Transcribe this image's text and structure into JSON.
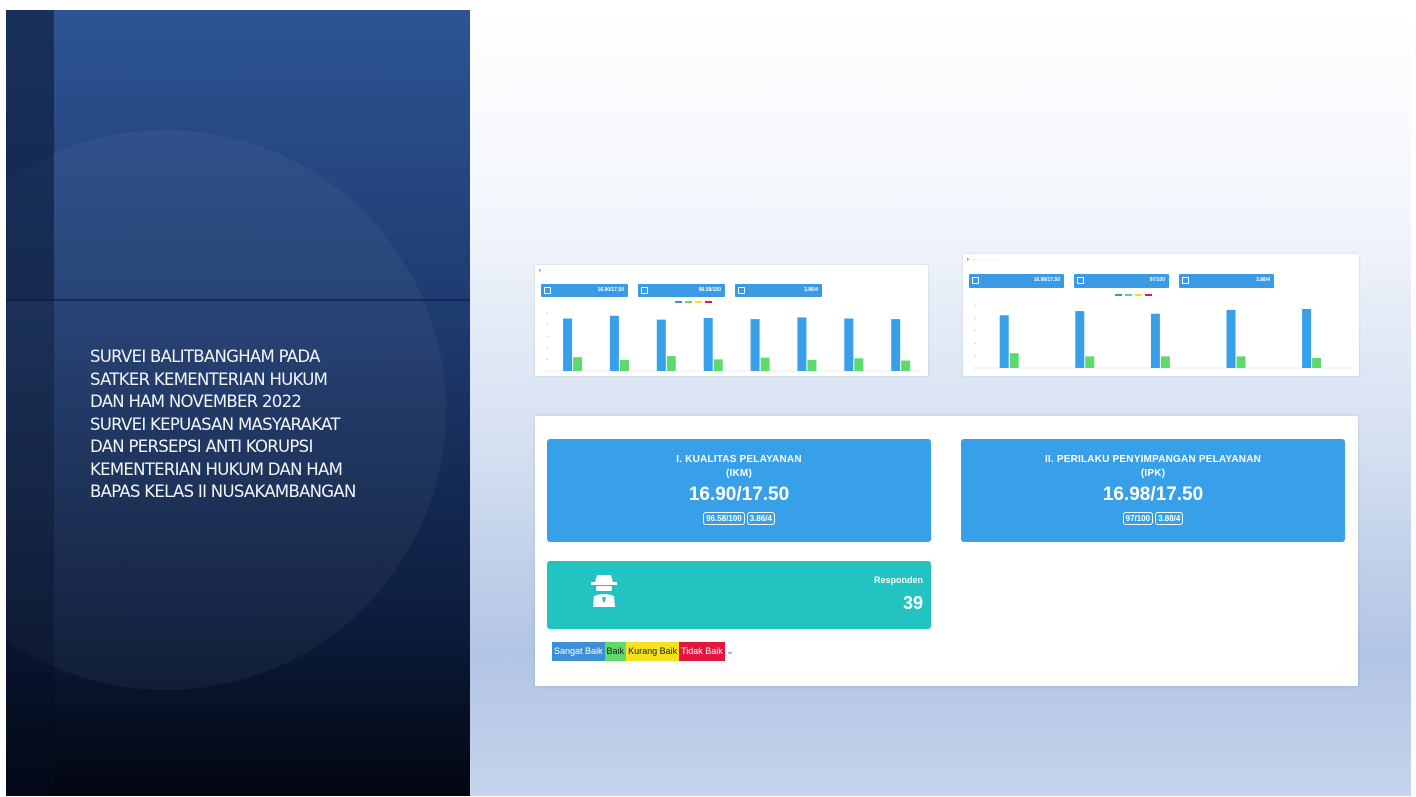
{
  "colors": {
    "blue": "#38a0e8",
    "teal": "#23c3c2",
    "green": "#5ed96c",
    "yellow": "#f5e21e",
    "red": "#e3163f",
    "navy": "#1e3a6e"
  },
  "slide": {
    "title_lines": [
      "SURVEI BALITBANGHAM PADA",
      "SATKER KEMENTERIAN HUKUM",
      "DAN HAM NOVEMBER 2022",
      "SURVEI KEPUASAN MASYARAKAT",
      "DAN PERSEPSI ANTI KORUPSI",
      "KEMENTERIAN HUKUM DAN HAM",
      "BAPAS KELAS II NUSAKAMBANGAN"
    ]
  },
  "dashboard": {
    "kualitas": {
      "label_line1": "I. KUALITAS PELAYANAN",
      "label_line2": "(IKM)",
      "value": "16.90/17.50",
      "chip1": "96.58/100",
      "chip2": "3.86/4"
    },
    "perilaku": {
      "label_line1": "II. PERILAKU PENYIMPANGAN PELAYANAN",
      "label_line2": "(IPK)",
      "value": "16.98/17.50",
      "chip1": "97/100",
      "chip2": "3.88/4"
    },
    "responden": {
      "label": "Responden",
      "count": "39",
      "icon": "spy-icon"
    },
    "legend": [
      {
        "label": "Sangat Baik",
        "color": "#3f8fd6",
        "text_color": "#ffffff"
      },
      {
        "label": "Baik",
        "color": "#5ed96c",
        "text_color": "#1a1a1a"
      },
      {
        "label": "Kurang Baik",
        "color": "#f5e21e",
        "text_color": "#1a1a1a"
      },
      {
        "label": "Tidak Baik",
        "color": "#e3163f",
        "text_color": "#ffffff"
      }
    ]
  },
  "chart_data": [
    {
      "type": "bar",
      "categories": [
        "",
        "",
        "",
        "",
        "",
        "",
        "",
        ""
      ],
      "series": [
        {
          "values": [
            95,
            100,
            93,
            96,
            94,
            97,
            95,
            94
          ]
        },
        {
          "values": [
            25,
            20,
            27,
            21,
            24,
            20,
            23,
            19
          ]
        }
      ],
      "stat_boxes": [
        "16.90/17.50",
        "96.58/100",
        "3.86/4"
      ]
    },
    {
      "type": "bar",
      "categories": [
        "",
        "",
        "",
        "",
        ""
      ],
      "series": [
        {
          "values": [
            100,
            108,
            103,
            110,
            112
          ]
        },
        {
          "values": [
            28,
            22,
            22,
            22,
            19
          ]
        }
      ],
      "stat_boxes": [
        "16.98/17.50",
        "97/100",
        "3.88/4"
      ]
    }
  ]
}
